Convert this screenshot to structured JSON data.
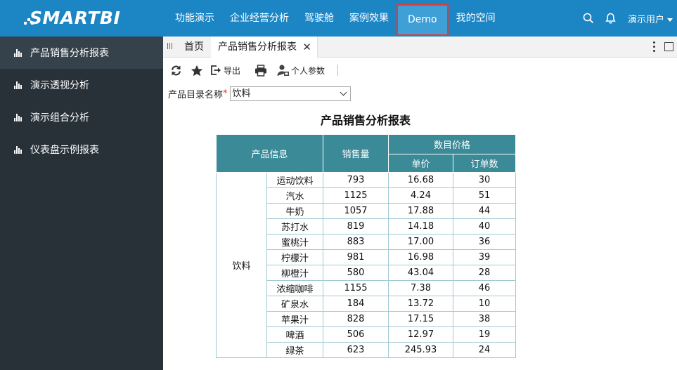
{
  "brand": {
    "name": "SMARTBI"
  },
  "nav": {
    "items": [
      {
        "label": "功能演示"
      },
      {
        "label": "企业经营分析"
      },
      {
        "label": "驾驶舱"
      },
      {
        "label": "案例效果"
      },
      {
        "label": "Demo"
      },
      {
        "label": "我的空间"
      }
    ],
    "active": "Demo",
    "user": "演示用户"
  },
  "sidebar": {
    "items": [
      {
        "label": "产品销售分析报表"
      },
      {
        "label": "演示透视分析"
      },
      {
        "label": "演示组合分析"
      },
      {
        "label": "仪表盘示例报表"
      }
    ]
  },
  "tabs": {
    "home": "首页",
    "current": "产品销售分析报表",
    "close": "✕"
  },
  "toolbar": {
    "export_label": "导出",
    "params_label": "个人参数"
  },
  "param": {
    "label": "产品目录名称",
    "required_mark": "*",
    "value": "饮料"
  },
  "report": {
    "title": "产品销售分析报表",
    "headers": {
      "product_info": "产品信息",
      "sales": "销售量",
      "price_group": "数目价格",
      "unit_price": "单价",
      "orders": "订单数"
    },
    "category": "饮料",
    "rows": [
      {
        "name": "运动饮料",
        "sales": "793",
        "price": "16.68",
        "orders": "30"
      },
      {
        "name": "汽水",
        "sales": "1125",
        "price": "4.24",
        "orders": "51"
      },
      {
        "name": "牛奶",
        "sales": "1057",
        "price": "17.88",
        "orders": "44"
      },
      {
        "name": "苏打水",
        "sales": "819",
        "price": "14.18",
        "orders": "40"
      },
      {
        "name": "蜜桃汁",
        "sales": "883",
        "price": "17.00",
        "orders": "36"
      },
      {
        "name": "柠檬汁",
        "sales": "981",
        "price": "16.98",
        "orders": "39"
      },
      {
        "name": "柳橙汁",
        "sales": "580",
        "price": "43.04",
        "orders": "28"
      },
      {
        "name": "浓缩咖啡",
        "sales": "1155",
        "price": "7.38",
        "orders": "46"
      },
      {
        "name": "矿泉水",
        "sales": "184",
        "price": "13.72",
        "orders": "10"
      },
      {
        "name": "苹果汁",
        "sales": "828",
        "price": "17.15",
        "orders": "38"
      },
      {
        "name": "啤酒",
        "sales": "506",
        "price": "12.97",
        "orders": "19"
      },
      {
        "name": "绿茶",
        "sales": "623",
        "price": "245.93",
        "orders": "24"
      }
    ]
  },
  "colors": {
    "topbar": "#1c86c5",
    "sidebar": "#283138",
    "header_cell": "#3a8a97",
    "active_outline": "#e53935"
  }
}
